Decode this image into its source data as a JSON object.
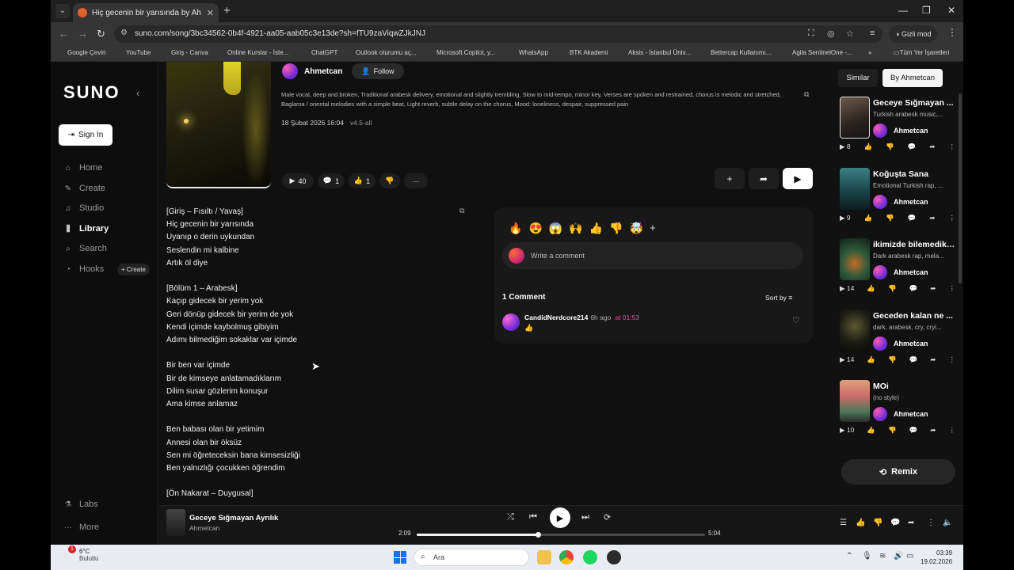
{
  "browser": {
    "tab_title": "Hiç gecenin bir yarısında by Ah",
    "url": "suno.com/song/3bc34562-0b4f-4921-aa05-aab05c3e13de?sh=fTU9zaViqwZJkJNJ",
    "incognito_label": "Gizli mod",
    "bookmarks": [
      {
        "label": "Google Çeviri",
        "color": "#4285f4"
      },
      {
        "label": "YouTube",
        "color": "#ff0000"
      },
      {
        "label": "Giriş - Canva",
        "color": "#00c4cc"
      },
      {
        "label": "Online Kurslar - İste...",
        "color": "#a435f0"
      },
      {
        "label": "ChatGPT",
        "color": "#333333"
      },
      {
        "label": "Outlook oturumu aç...",
        "color": "#888888"
      },
      {
        "label": "Microsoft Copilot, y...",
        "color": "#8a5cf6"
      },
      {
        "label": "WhatsApp",
        "color": "#25d366"
      },
      {
        "label": "BTK Akademi",
        "color": "#e03131"
      },
      {
        "label": "Aksis - İstanbul Üniv...",
        "color": "#d4a017"
      },
      {
        "label": "Bettercap Kullanımı...",
        "color": "#b04848"
      },
      {
        "label": "Agila SentinelOne -...",
        "color": "#7b2ff7"
      }
    ],
    "all_bookmarks_label": "Tüm Yer İşaretleri"
  },
  "sidebar": {
    "logo": "SUNO",
    "signin_label": "Sign In",
    "nav": [
      {
        "label": "Home",
        "icon": "home-icon"
      },
      {
        "label": "Create",
        "icon": "create-icon"
      },
      {
        "label": "Studio",
        "icon": "studio-icon"
      },
      {
        "label": "Library",
        "icon": "library-icon"
      },
      {
        "label": "Search",
        "icon": "search-icon"
      },
      {
        "label": "Hooks",
        "icon": "hooks-icon"
      }
    ],
    "hooks_create_label": "+ Create",
    "labs_label": "Labs",
    "more_label": "More"
  },
  "song": {
    "artist": "Ahmetcan",
    "follow_label": "Follow",
    "style": "Male vocal, deep and broken, Traditional arabesk delivery, emotional and slightly trembling, Slow to mid-tempo, minor key, Verses are spoken and restrained, chorus is melodic and stretched, Baglama / oriental melodies with a simple beat, Light reverb, subtle delay on the chorus, Mood: loneliness, despair, suppressed pain",
    "date": "18 Şubat 2026 16:04",
    "version": "v4.5-all",
    "plays": "40",
    "comments_count": "1",
    "likes": "1"
  },
  "lyrics": [
    "[Giriş – Fısıltı / Yavaş]",
    "Hiç gecenin bir yarısında",
    "Uyanıp o derin uykundan",
    "Seslendin mi kalbine",
    "Artık öl diye",
    "",
    "[Bölüm 1 – Arabesk]",
    "Kaçıp gidecek bir yerim yok",
    "Geri dönüp gidecek bir yerim de yok",
    "Kendi içimde kaybolmuş gibiyim",
    "Adımı bilmediğim sokaklar var içimde",
    "",
    "Bir ben var içimde",
    "Bir de kimseye anlatamadıklarım",
    "Dilim susar gözlerim konuşur",
    "Ama kimse anlamaz",
    "",
    "Ben babası olan bir yetimim",
    "Annesi olan bir öksüz",
    "Sen mi öğreteceksin bana kimsesizliği",
    "Ben yalnızlığı çocukken öğrendim",
    "",
    "[Ön Nakarat – Duygusal]"
  ],
  "comments": {
    "reactions": [
      "🔥",
      "😍",
      "😱",
      "🙌",
      "👍",
      "👎",
      "🤯"
    ],
    "placeholder": "Write a comment",
    "count_label": "1 Comment",
    "sort_label": "Sort by",
    "items": [
      {
        "user": "CandidNerdcore214",
        "ago": "6h ago",
        "at": "at 01:53",
        "text": "👍"
      }
    ]
  },
  "right_panel": {
    "tab_similar": "Similar",
    "tab_by": "By Ahmetcan",
    "songs": [
      {
        "title": "Geceye Sığmayan ...",
        "style": "Turkish arabesk music,...",
        "artist": "Ahmetcan",
        "plays": "8"
      },
      {
        "title": "Koğuşta Sana",
        "style": "Emotional Turkish rap, ...",
        "artist": "Ahmetcan",
        "plays": "9"
      },
      {
        "title": "ikimizde bilemedik ...",
        "style": "Dark arabesk rap, mela...",
        "artist": "Ahmetcan",
        "plays": "14"
      },
      {
        "title": "Geceden kalan ne ...",
        "style": "dark, arabesk, cry, cryi...",
        "artist": "Ahmetcan",
        "plays": "14"
      },
      {
        "title": "MOi",
        "style": "(no style)",
        "artist": "Ahmetcan",
        "plays": "10"
      }
    ],
    "remix_label": "Remix"
  },
  "player": {
    "title": "Geceye Sığmayan Ayrılık",
    "artist": "Ahmetcan",
    "elapsed": "2:09",
    "duration": "5:04",
    "progress": 0.42
  },
  "taskbar": {
    "weather_badge": "1",
    "temp": "6°C",
    "condition": "Bulutlu",
    "search_placeholder": "Ara",
    "time": "03:39",
    "date": "19.02.2026"
  }
}
